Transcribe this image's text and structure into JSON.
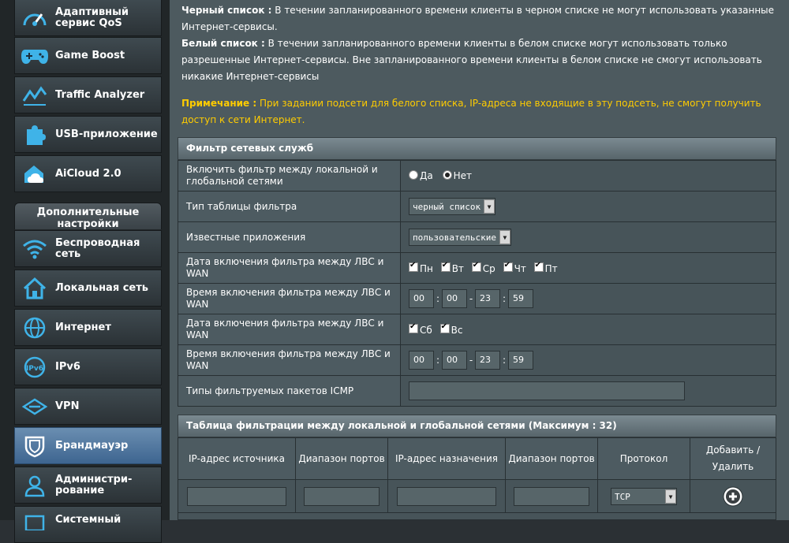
{
  "sidebar": {
    "items": [
      {
        "label": "Адаптивный сервис QoS",
        "icon": "speedometer-icon"
      },
      {
        "label": "Game Boost",
        "icon": "gamepad-icon"
      },
      {
        "label": "Traffic Analyzer",
        "icon": "traffic-analyzer-icon"
      },
      {
        "label": "USB-приложение",
        "icon": "puzzle-icon"
      },
      {
        "label": "AiCloud 2.0",
        "icon": "cloud-home-icon"
      }
    ],
    "section_title": "Дополнительные настройки",
    "advanced_items": [
      {
        "label": "Беспроводная сеть",
        "icon": "wifi-icon"
      },
      {
        "label": "Локальная сеть",
        "icon": "home-icon"
      },
      {
        "label": "Интернет",
        "icon": "globe-icon"
      },
      {
        "label": "IPv6",
        "icon": "ipv6-icon"
      },
      {
        "label": "VPN",
        "icon": "vpn-icon"
      },
      {
        "label": "Брандмауэр",
        "icon": "shield-icon"
      },
      {
        "label": "Администри-рование",
        "icon": "admin-user-icon"
      },
      {
        "label": "Системный",
        "icon": "system-log-icon"
      }
    ]
  },
  "description": {
    "blacklist_label": "Черный список :",
    "blacklist_text": " В течении запланированного времени клиенты в черном списке не могут использовать указанные Интернет-сервисы.",
    "whitelist_label": "Белый список :",
    "whitelist_text": " В течении запланированного времени клиенты в белом списке могут использовать только разрешенные Интернет-сервисы. Вне запланированного времени клиенты в белом списке не смогут использовать никакие Интернет-сервисы",
    "note_label": "Примечание :",
    "note_text": " При задании подсети для белого списка, IP-адреса не входящие в эту подсеть, не смогут получить доступ к сети Интернет."
  },
  "filter_panel": {
    "title": "Фильтр сетевых служб",
    "enable_label": "Включить фильтр между локальной и глобальной сетями",
    "enable_yes": "Да",
    "enable_no": "Нет",
    "enable_value": "Нет",
    "table_type_label": "Тип таблицы фильтра",
    "table_type_value": "черный список",
    "known_apps_label": "Известные приложения",
    "known_apps_value": "пользовательские",
    "weekday_date_label": "Дата включения фильтра между ЛВС и WAN",
    "weekdays": [
      "Пн",
      "Вт",
      "Ср",
      "Чт",
      "Пт"
    ],
    "weekday_time_label": "Время включения фильтра между ЛВС и WAN",
    "weekday_time": [
      "00",
      "00",
      "23",
      "59"
    ],
    "weekend_date_label": "Дата включения фильтра между ЛВС и WAN",
    "weekend_days": [
      "Сб",
      "Вс"
    ],
    "weekend_time_label": "Время включения фильтра между ЛВС и WAN",
    "weekend_time": [
      "00",
      "00",
      "23",
      "59"
    ],
    "icmp_label": "Типы фильтруемых пакетов ICMP",
    "icmp_value": ""
  },
  "rules_panel": {
    "title": "Таблица фильтрации между локальной и глобальной сетями (Максимум : 32)",
    "columns": [
      "IP-адрес источника",
      "Диапазон портов",
      "IP-адрес назначения",
      "Диапазон портов",
      "Протокол",
      "Добавить / Удалить"
    ],
    "protocol_value": "TCP"
  },
  "colors": {
    "note": "#ffcc00",
    "active_item": "#4f77a0"
  }
}
